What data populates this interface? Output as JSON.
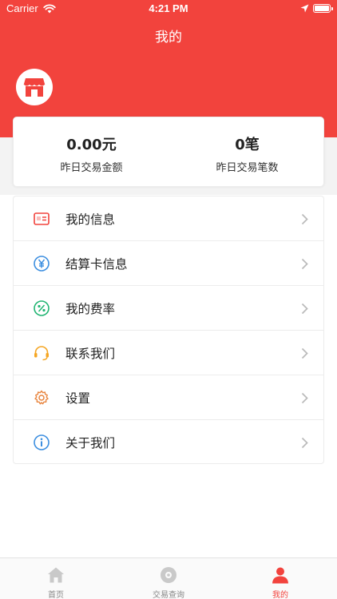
{
  "status_bar": {
    "carrier": "Carrier",
    "time": "4:21 PM"
  },
  "header": {
    "title": "我的",
    "color": "#f2433d"
  },
  "stats": [
    {
      "value": "0.00元",
      "label": "昨日交易金额"
    },
    {
      "value": "0笔",
      "label": "昨日交易笔数"
    }
  ],
  "menu": [
    {
      "label": "我的信息",
      "icon": "id-card-icon"
    },
    {
      "label": "结算卡信息",
      "icon": "yen-icon"
    },
    {
      "label": "我的费率",
      "icon": "percent-icon"
    },
    {
      "label": "联系我们",
      "icon": "headset-icon"
    },
    {
      "label": "设置",
      "icon": "gear-icon"
    },
    {
      "label": "关于我们",
      "icon": "info-icon"
    }
  ],
  "tabs": [
    {
      "label": "首页",
      "icon": "home-icon",
      "active": false
    },
    {
      "label": "交易查询",
      "icon": "disc-icon",
      "active": false
    },
    {
      "label": "我的",
      "icon": "person-icon",
      "active": true
    }
  ]
}
